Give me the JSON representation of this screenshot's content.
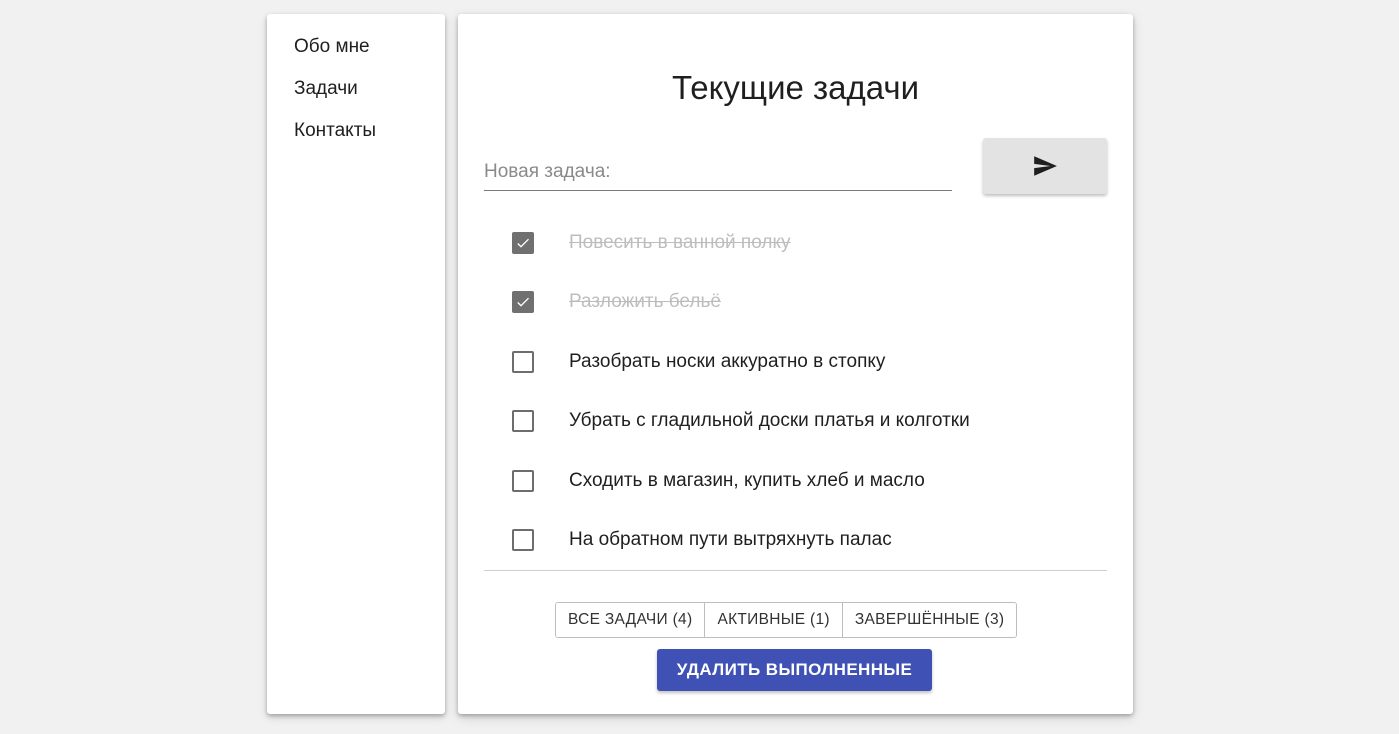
{
  "nav": {
    "items": [
      {
        "label": "Обо мне"
      },
      {
        "label": "Задачи"
      },
      {
        "label": "Контакты"
      }
    ]
  },
  "main": {
    "title": "Текущие задачи",
    "new_task": {
      "placeholder": "Новая задача:",
      "value": ""
    },
    "send_button_icon": "send-icon",
    "tasks": [
      {
        "text": "Повесить в ванной полку",
        "completed": true
      },
      {
        "text": "Разложить бельё",
        "completed": true
      },
      {
        "text": "Разобрать носки аккуратно в стопку",
        "completed": false
      },
      {
        "text": "Убрать с гладильной доски платья и колготки",
        "completed": false
      },
      {
        "text": "Сходить в магазин, купить хлеб и масло",
        "completed": false
      },
      {
        "text": "На обратном пути вытряхнуть палас",
        "completed": false
      }
    ],
    "filters": [
      {
        "label": "ВСЕ ЗАДАЧИ (4)"
      },
      {
        "label": "АКТИВНЫЕ (1)"
      },
      {
        "label": "ЗАВЕРШЁННЫЕ (3)"
      }
    ],
    "clear_button_label": "УДАЛИТЬ ВЫПОЛНЕННЫЕ"
  },
  "colors": {
    "background": "#f1f1f1",
    "card": "#ffffff",
    "accent": "#3f51b5",
    "checkbox_checked": "#707070",
    "completed_text": "#bdbdbd"
  }
}
